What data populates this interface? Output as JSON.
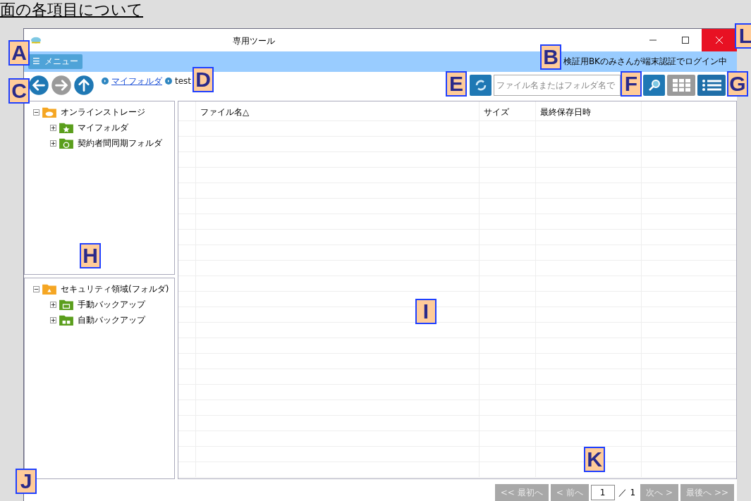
{
  "heading": "面の各項目について",
  "window": {
    "title": "専用ツール"
  },
  "menu_button": {
    "icon": "☰",
    "label": "メニュー"
  },
  "login_status": "検証用BKのみさんが端末認証でログイン中",
  "nav_buttons": [
    {
      "kind": "back",
      "disabled": false
    },
    {
      "kind": "forward",
      "disabled": true
    },
    {
      "kind": "up",
      "disabled": false
    }
  ],
  "breadcrumb": [
    {
      "label": "マイフォルダ",
      "link": true
    },
    {
      "label": "test",
      "link": false
    }
  ],
  "search": {
    "placeholder": "ファイル名またはフォルダ名で"
  },
  "view_buttons": [
    {
      "kind": "grid",
      "selected": false
    },
    {
      "kind": "list",
      "selected": true
    }
  ],
  "trees": [
    {
      "label": "オンラインストレージ",
      "kind": "cloud",
      "expanded": true,
      "children": [
        {
          "label": "マイフォルダ",
          "kind": "star",
          "expanded": false
        },
        {
          "label": "契約者間同期フォルダ",
          "kind": "sync",
          "expanded": false
        }
      ]
    },
    {
      "label": "セキュリティ領域(フォルダ)",
      "kind": "lock",
      "expanded": true,
      "children": [
        {
          "label": "手動バックアップ",
          "kind": "manual",
          "expanded": false
        },
        {
          "label": "自動バックアップ",
          "kind": "auto",
          "expanded": false
        }
      ]
    }
  ],
  "table": {
    "columns": [
      "ファイル名△",
      "サイズ",
      "最終保存日時"
    ]
  },
  "pagination": {
    "first": "<< 最初へ",
    "prev": "< 前へ",
    "page": "1",
    "separator": "／",
    "total": "1",
    "next": "次へ >",
    "last": "最後へ >>",
    "disabled": true
  },
  "callouts": [
    "A",
    "B",
    "C",
    "D",
    "E",
    "F",
    "G",
    "H",
    "I",
    "J",
    "K",
    "L"
  ]
}
